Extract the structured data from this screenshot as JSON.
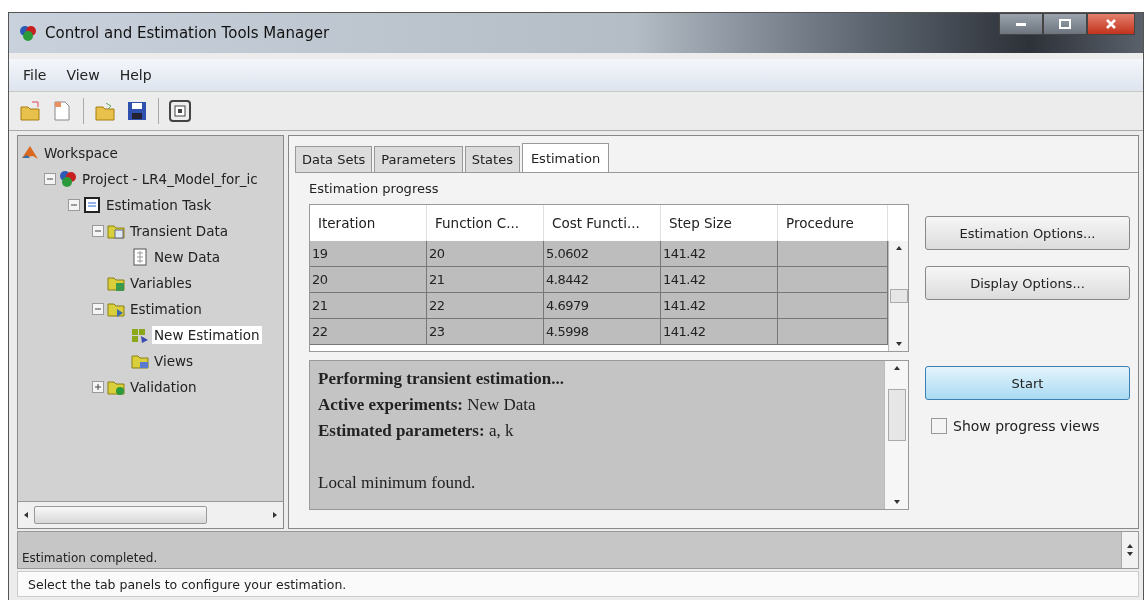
{
  "window": {
    "title": "Control and Estimation Tools Manager"
  },
  "menu": [
    "File",
    "View",
    "Help"
  ],
  "tree": [
    {
      "label": "Workspace",
      "kind": "workspace",
      "selected": false,
      "children": [
        {
          "label": "Project - LR4_Model_for_ic",
          "kind": "project",
          "selected": false,
          "expanded": true,
          "children": [
            {
              "label": "Estimation Task",
              "kind": "task",
              "selected": false,
              "expanded": true,
              "children": [
                {
                  "label": "Transient Data",
                  "kind": "datafolder",
                  "selected": false,
                  "expanded": true,
                  "children": [
                    {
                      "label": "New Data",
                      "kind": "data",
                      "selected": false
                    }
                  ]
                },
                {
                  "label": "Variables",
                  "kind": "varfolder",
                  "selected": false
                },
                {
                  "label": "Estimation",
                  "kind": "estfolder",
                  "selected": false,
                  "expanded": true,
                  "children": [
                    {
                      "label": "New Estimation",
                      "kind": "estimation",
                      "selected": true
                    },
                    {
                      "label": "Views",
                      "kind": "viewfolder",
                      "selected": false
                    }
                  ]
                },
                {
                  "label": "Validation",
                  "kind": "valfolder",
                  "selected": false,
                  "expanded": false
                }
              ]
            }
          ]
        }
      ]
    }
  ],
  "tabs": [
    {
      "label": "Data Sets",
      "selected": false
    },
    {
      "label": "Parameters",
      "selected": false
    },
    {
      "label": "States",
      "selected": false
    },
    {
      "label": "Estimation",
      "selected": true
    }
  ],
  "progress": {
    "title": "Estimation progress",
    "columns": [
      "Iteration",
      "Function C...",
      "Cost Functi...",
      "Step Size",
      "Procedure"
    ],
    "rows": [
      [
        "19",
        "20",
        "5.0602",
        "141.42",
        ""
      ],
      [
        "20",
        "21",
        "4.8442",
        "141.42",
        ""
      ],
      [
        "21",
        "22",
        "4.6979",
        "141.42",
        ""
      ],
      [
        "22",
        "23",
        "4.5998",
        "141.42",
        ""
      ]
    ],
    "log": [
      "**Performing transient estimation...**",
      "**Active experiments:** New Data",
      "**Estimated parameters:** a, k",
      "Local minimum found."
    ]
  },
  "buttons": [
    {
      "label": "Estimation Options...",
      "kind": "normal"
    },
    {
      "label": "Display Options...",
      "kind": "normal"
    },
    {
      "label": "Start",
      "kind": "default"
    }
  ],
  "show_progress": {
    "label": "Show progress views",
    "checked": false
  },
  "message_log": "Estimation completed.",
  "status_bar": "Select the tab panels to configure your estimation."
}
